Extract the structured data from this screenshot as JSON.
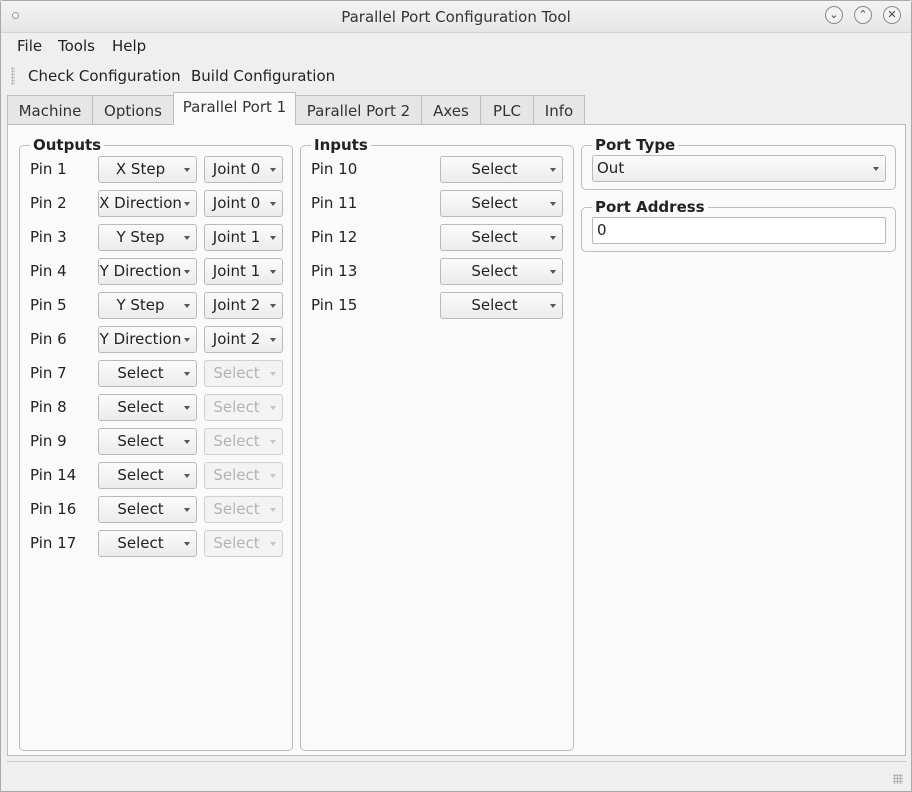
{
  "window": {
    "title": "Parallel Port Configuration Tool"
  },
  "menu": [
    "File",
    "Tools",
    "Help"
  ],
  "toolbar": {
    "check_label": "Check Configuration",
    "build_label": "Build Configuration"
  },
  "tabs": [
    {
      "label": "Machine",
      "active": false
    },
    {
      "label": "Options",
      "active": false
    },
    {
      "label": "Parallel Port 1",
      "active": true
    },
    {
      "label": "Parallel Port 2",
      "active": false
    },
    {
      "label": "Axes",
      "active": false
    },
    {
      "label": "PLC",
      "active": false
    },
    {
      "label": "Info",
      "active": false
    }
  ],
  "outputs": {
    "title": "Outputs",
    "rows": [
      {
        "pin": "Pin 1",
        "function": "X Step",
        "joint": "Joint 0",
        "joint_enabled": true
      },
      {
        "pin": "Pin 2",
        "function": "X Direction",
        "joint": "Joint 0",
        "joint_enabled": true
      },
      {
        "pin": "Pin 3",
        "function": "Y Step",
        "joint": "Joint 1",
        "joint_enabled": true
      },
      {
        "pin": "Pin 4",
        "function": "Y Direction",
        "joint": "Joint 1",
        "joint_enabled": true
      },
      {
        "pin": "Pin 5",
        "function": "Y Step",
        "joint": "Joint 2",
        "joint_enabled": true
      },
      {
        "pin": "Pin 6",
        "function": "Y Direction",
        "joint": "Joint 2",
        "joint_enabled": true
      },
      {
        "pin": "Pin 7",
        "function": "Select",
        "joint": "Select",
        "joint_enabled": false
      },
      {
        "pin": "Pin 8",
        "function": "Select",
        "joint": "Select",
        "joint_enabled": false
      },
      {
        "pin": "Pin 9",
        "function": "Select",
        "joint": "Select",
        "joint_enabled": false
      },
      {
        "pin": "Pin 14",
        "function": "Select",
        "joint": "Select",
        "joint_enabled": false
      },
      {
        "pin": "Pin 16",
        "function": "Select",
        "joint": "Select",
        "joint_enabled": false
      },
      {
        "pin": "Pin 17",
        "function": "Select",
        "joint": "Select",
        "joint_enabled": false
      }
    ]
  },
  "inputs": {
    "title": "Inputs",
    "rows": [
      {
        "pin": "Pin 10",
        "function": "Select"
      },
      {
        "pin": "Pin 11",
        "function": "Select"
      },
      {
        "pin": "Pin 12",
        "function": "Select"
      },
      {
        "pin": "Pin 13",
        "function": "Select"
      },
      {
        "pin": "Pin 15",
        "function": "Select"
      }
    ]
  },
  "port_type": {
    "title": "Port Type",
    "value": "Out"
  },
  "port_address": {
    "title": "Port Address",
    "value": "0"
  },
  "icons": {
    "window_menu": "window-menu-dot-icon",
    "minimize": "minimize-icon",
    "maximize": "maximize-icon",
    "close": "close-icon",
    "toolbar_grip": "toolbar-grip-icon",
    "dropdown_arrow": "dropdown-arrow-icon",
    "size_grip": "size-grip-icon"
  }
}
